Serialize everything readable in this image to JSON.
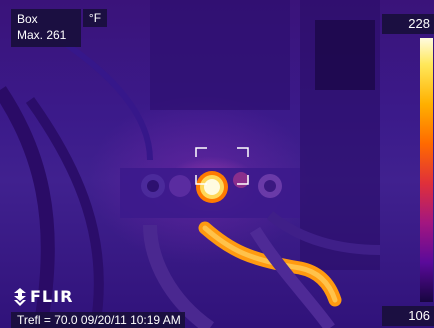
{
  "overlay": {
    "mode_label": "Box",
    "max_label": "Max. 261",
    "unit": "°F"
  },
  "scale": {
    "max": "228",
    "min": "106"
  },
  "brand": {
    "logo_text": "FLIR"
  },
  "status": {
    "text": "Trefl = 70.0  09/20/11 10:19 AM"
  },
  "colors": {
    "background": "#3a137a",
    "hot": "#ffb000",
    "hottest": "#fffbe0"
  }
}
